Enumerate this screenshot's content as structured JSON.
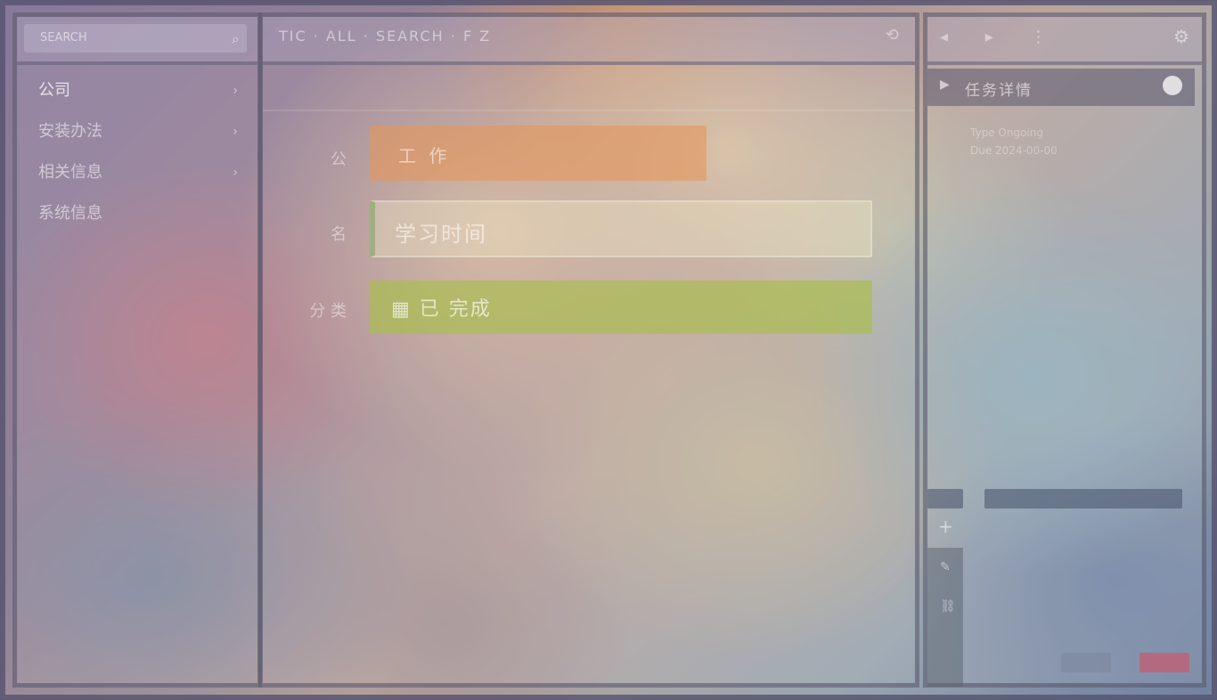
{
  "left_pane": {
    "search_placeholder": "SEARCH",
    "nav": [
      {
        "label": "公司",
        "chevron": "›"
      },
      {
        "label": "安装办法",
        "chevron": "›"
      },
      {
        "label": "相关信息",
        "chevron": "›"
      },
      {
        "label": "系统信息",
        "chevron": ""
      }
    ]
  },
  "mid_pane": {
    "toolbar_text": "TIC · ALL · SEARCH · F Z",
    "toolbar_icon": "⟲",
    "rows": [
      {
        "label": "公",
        "value": "工 作"
      },
      {
        "label": "名",
        "value": "学习时间"
      },
      {
        "label": "分 类",
        "value": "已 完成"
      }
    ]
  },
  "right_pane": {
    "toolbar_icons": "◂ ▸ ⋮",
    "panel_title": "任务详情",
    "meta_lines": [
      "Type   Ongoing",
      "Due    2024-00-00"
    ],
    "plus": "+"
  },
  "colors": {
    "accent_orange": "#e4965a",
    "accent_green": "#aabe50",
    "danger": "#c85a6e"
  }
}
